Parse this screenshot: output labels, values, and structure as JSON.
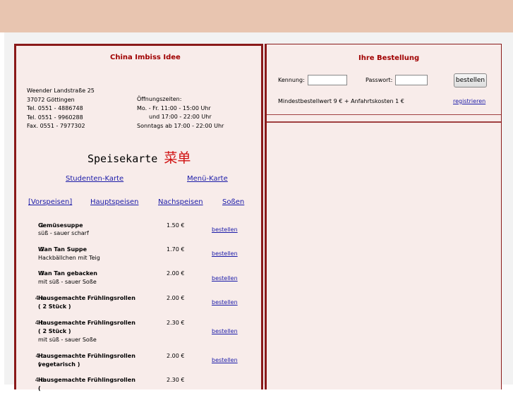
{
  "restaurant": {
    "name": "China Imbiss Idee",
    "address": [
      "Weender Landstraße 25",
      "37072 Göttingen"
    ],
    "phones": [
      "Tel. 0551 - 4886748",
      "Tel. 0551 - 9960288",
      "Fax. 0551 - 7977302"
    ],
    "hours_title": "Öffnungszeiten:",
    "hours": [
      "Mo. - Fr. 11:00 - 15:00 Uhr",
      "und 17:00 - 22:00 Uhr",
      "Sonntags ab 17:00 - 22:00 Uhr"
    ]
  },
  "menu": {
    "heading": "Speisekarte",
    "heading_cjk": "菜单",
    "cards": [
      "Studenten-Karte",
      "Menü-Karte"
    ],
    "categories": [
      "[Vorspeisen]",
      "Hauptspeisen",
      "Nachspeisen",
      "Soßen"
    ],
    "order_label": "bestellen",
    "items": [
      {
        "num": "1.",
        "name": "Gemüsesuppe",
        "desc": "süß - sauer scharf",
        "price": "1.50 €"
      },
      {
        "num": "2.",
        "name": "Wan Tan Suppe",
        "desc": "Hackbällchen mit Teig",
        "price": "1.70 €"
      },
      {
        "num": "3.",
        "name": "Wan Tan gebacken",
        "desc": "mit süß - sauer Soße",
        "price": "2.00 €"
      },
      {
        "num": "4 a.",
        "name": "Hausgemachte Frühlingsrollen",
        "name2": "( 2 Stück )",
        "desc": "",
        "price": "2.00 €"
      },
      {
        "num": "4 b.",
        "name": "Hausgemachte Frühlingsrollen",
        "name2": "( 2 Stück )",
        "desc": "mit süß - sauer Soße",
        "price": "2.30 €"
      },
      {
        "num": "4 c.",
        "name": "Hausgemachte Frühlingsrollen (",
        "name2": "vegetarisch )",
        "desc": "",
        "price": "2.00 €"
      },
      {
        "num": "4 d.",
        "name": "Hausgemachte Frühlingsrollen (",
        "desc": "",
        "price": "2.30 €"
      }
    ]
  },
  "order": {
    "title": "Ihre Bestellung",
    "kennung_label": "Kennung:",
    "passwort_label": "Passwort:",
    "button_label": "bestellen",
    "min_text": "Mindestbestellwert 9 € + Anfahrtskosten 1 €",
    "register_label": "registrieren"
  },
  "colors": {
    "accent": "#a00000",
    "border": "#8a1a1a",
    "link": "#1a1aa8",
    "top_band": "#e8c5b0"
  }
}
